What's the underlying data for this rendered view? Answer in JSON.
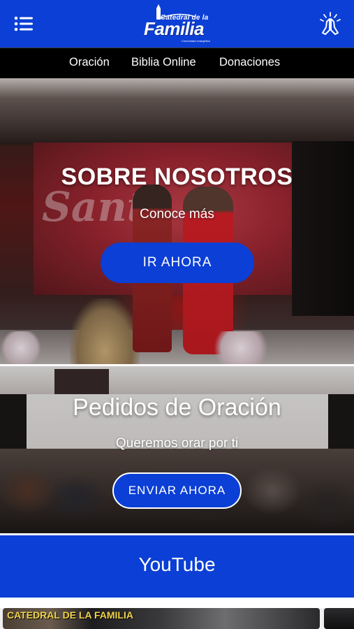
{
  "brand": {
    "logo_top": "Catedral de la",
    "logo_main": "Familia",
    "logo_sub": "Comunidad evangélica"
  },
  "header": {
    "menu_icon": "hamburger-menu-icon",
    "pray_icon": "praying-hands-icon",
    "background": "#0b3fd6"
  },
  "nav": {
    "items": [
      {
        "label": "Oración"
      },
      {
        "label": "Biblia Online"
      },
      {
        "label": "Donaciones"
      }
    ]
  },
  "hero_about": {
    "title": "SOBRE NOSOTROS",
    "subtitle": "Conoce más",
    "button_label": "IR AHORA",
    "screen_text": "Santa"
  },
  "hero_prayer": {
    "title": "Pedidos de Oración",
    "subtitle": "Queremos orar por ti",
    "button_label": "ENVIAR AHORA"
  },
  "youtube": {
    "title": "YouTube"
  },
  "videos": {
    "first_label": "CATEDRAL DE LA FAMILIA"
  },
  "colors": {
    "accent": "#0b3fd6",
    "nav_bg": "#000000"
  }
}
